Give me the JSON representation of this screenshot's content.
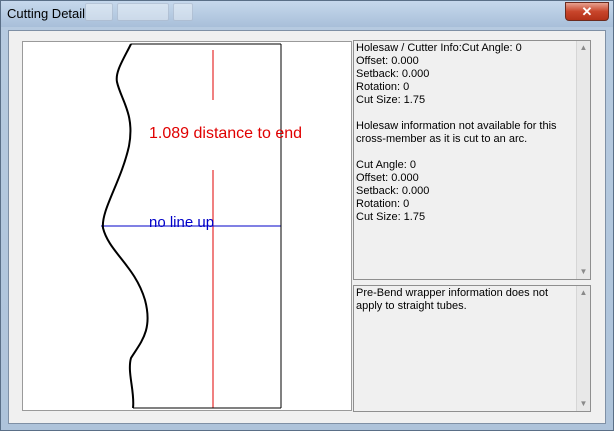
{
  "window": {
    "title": "Cutting Detail",
    "close_label": "✕"
  },
  "drawing": {
    "distance_label": "1.089  distance  to  end",
    "lineup_label": "no  line  up"
  },
  "holesaw_panel": {
    "text": "Holesaw / Cutter Info:Cut Angle: 0\nOffset: 0.000\nSetback: 0.000\nRotation: 0\nCut Size: 1.75\n\nHolesaw information not available for this cross-member as it is cut to an arc.\n\nCut Angle: 0\nOffset: 0.000\nSetback: 0.000\nRotation: 0\nCut Size: 1.75"
  },
  "prebend_panel": {
    "text": "Pre-Bend wrapper information does not apply to straight tubes."
  },
  "colors": {
    "distance": "#e00000",
    "lineup": "#0000c8",
    "outline": "#000000"
  },
  "icons": {
    "scroll_up": "triangle-up-icon",
    "scroll_down": "triangle-down-icon"
  }
}
